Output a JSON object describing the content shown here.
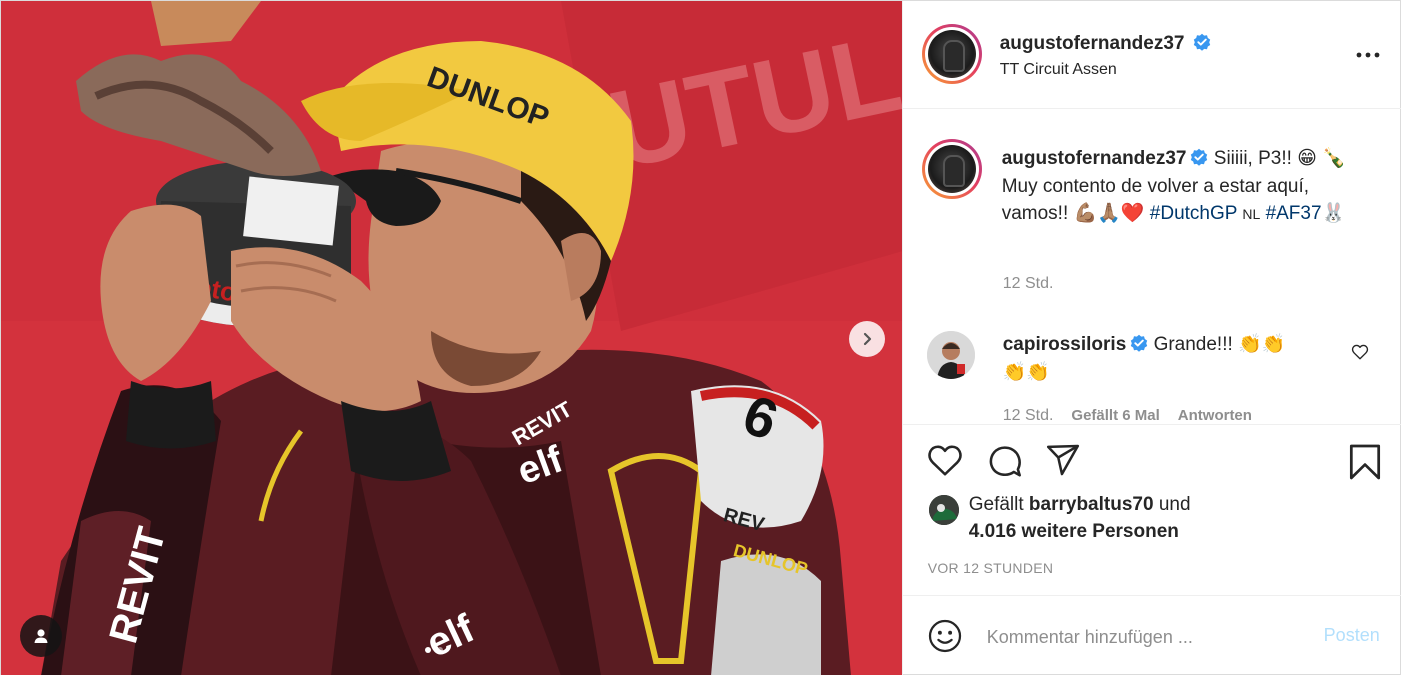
{
  "post": {
    "author": {
      "username": "augustofernandez37",
      "location": "TT Circuit Assen",
      "verified": true
    },
    "caption": {
      "username": "augustofernandez37",
      "text_part1": "Siiiii, P3!! 😁",
      "text_part2": "🍾 Muy contento de volver a estar aquí, vamos!! 💪🏽🙏🏽❤️",
      "hashtag1": "#DutchGP",
      "flag_label": "NL",
      "hashtag2": "#AF37",
      "emoji_end": "🐰",
      "time": "12 Std."
    },
    "comments": [
      {
        "username": "capirossiloris",
        "text": "Grande!!! 👏👏",
        "text2": "👏👏",
        "time": "12 Std.",
        "likes": "Gefällt 6 Mal",
        "reply": "Antworten"
      }
    ],
    "likes": {
      "prefix": "Gefällt",
      "user": "barrybaltus70",
      "joiner": "und",
      "others": "4.016 weitere Personen"
    },
    "timestamp": "VOR 12 STUNDEN",
    "comment_input": {
      "placeholder": "Kommentar hinzufügen ..."
    },
    "post_button": "Posten",
    "media": {
      "carousel_total": 2,
      "carousel_index": 1
    }
  },
  "colors": {
    "verified_blue": "#3897f0",
    "hashtag": "#00376b",
    "muted": "#8e8e8e",
    "post_disabled": "#b2dffc",
    "background_red": "#d8313c"
  },
  "icons": [
    "chevron-right-icon",
    "user-tag-icon",
    "more-options-icon",
    "verified-badge-icon",
    "heart-icon",
    "comment-icon",
    "share-icon",
    "bookmark-icon",
    "emoji-icon",
    "small-heart-icon"
  ]
}
